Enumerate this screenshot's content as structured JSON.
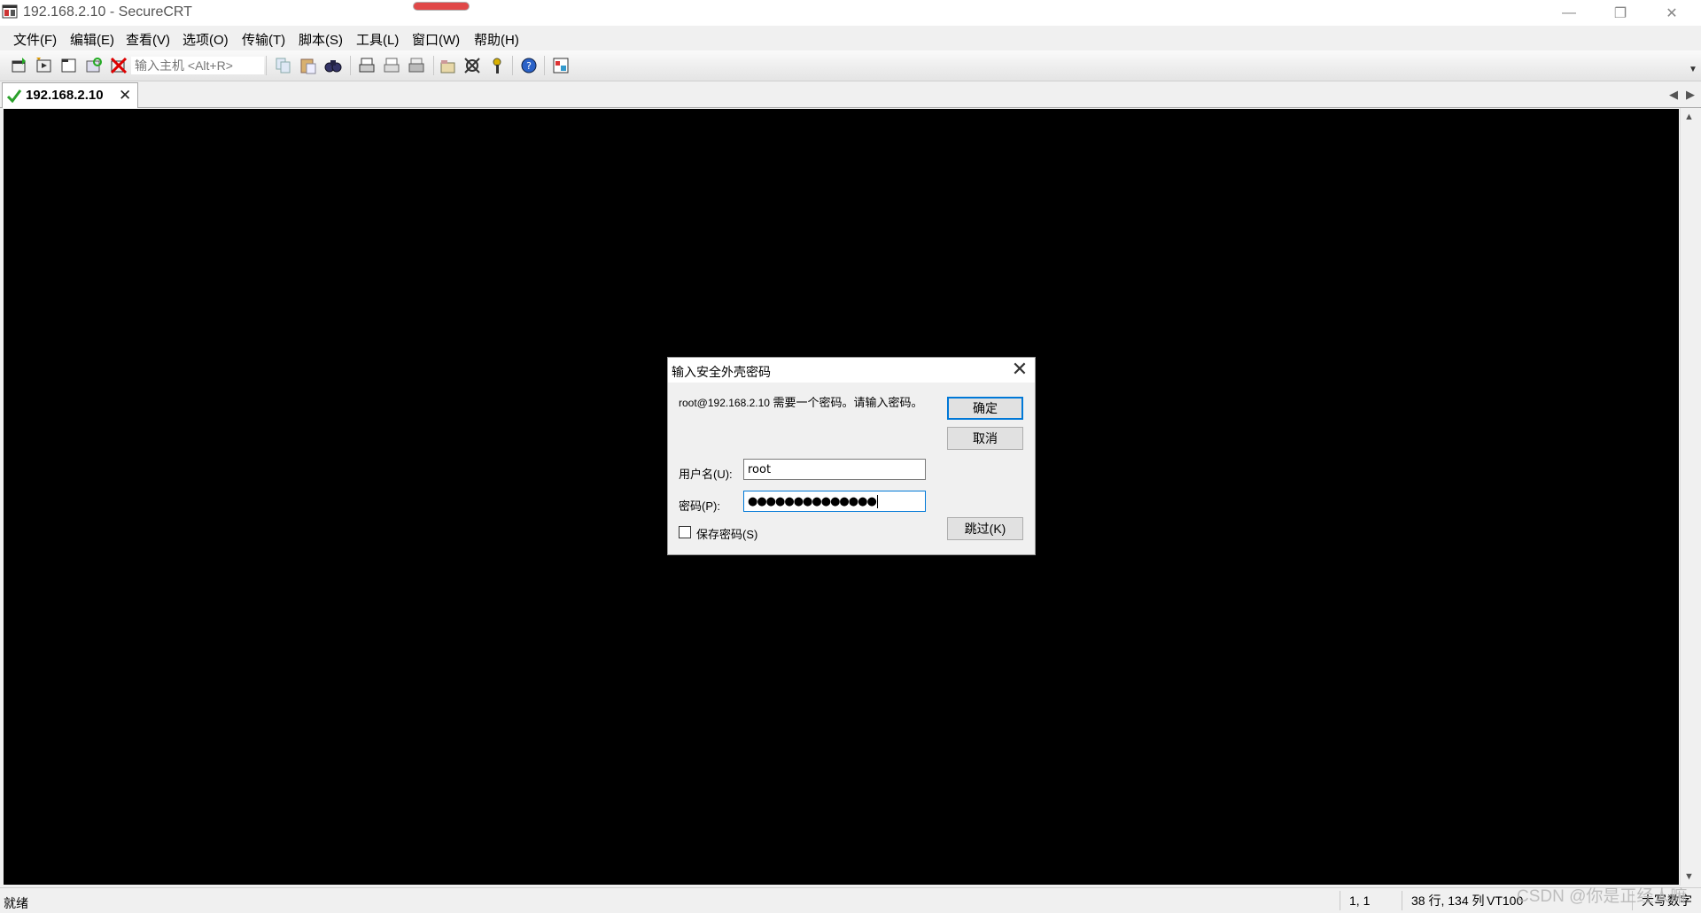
{
  "window": {
    "title": "192.168.2.10 - SecureCRT",
    "minimize_glyph": "—",
    "restore_glyph": "❐",
    "close_glyph": "✕"
  },
  "menu": {
    "items": [
      {
        "label": "文件(F)"
      },
      {
        "label": "编辑(E)"
      },
      {
        "label": "查看(V)"
      },
      {
        "label": "选项(O)"
      },
      {
        "label": "传输(T)"
      },
      {
        "label": "脚本(S)"
      },
      {
        "label": "工具(L)"
      },
      {
        "label": "窗口(W)"
      },
      {
        "label": "帮助(H)"
      }
    ]
  },
  "toolbar": {
    "quick_connect_placeholder": "输入主机 <Alt+R>",
    "icons": [
      "connect-icon",
      "quick-connect-icon",
      "connect-in-tab-icon",
      "reconnect-icon",
      "disconnect-icon",
      "copy-icon",
      "paste-icon",
      "find-icon",
      "print-icon",
      "print-selection-icon",
      "printer-icon",
      "session-options-icon",
      "global-options-icon",
      "keymap-icon",
      "help-icon",
      "sftp-icon"
    ]
  },
  "tabs": {
    "items": [
      {
        "label": "192.168.2.10",
        "status": "connected",
        "close": "✕"
      }
    ],
    "nav_left": "◀",
    "nav_right": "▶"
  },
  "dialog": {
    "title": "输入安全外壳密码",
    "close_glyph": "✕",
    "message_host": "root@192.168.2.10",
    "message_text": " 需要一个密码。请输入密码。",
    "username_label": "用户名(U):",
    "username_value": "root",
    "password_label": "密码(P):",
    "password_masked": "●●●●●●●●●●●●●●",
    "ok_label": "确定",
    "cancel_label": "取消",
    "skip_label": "跳过(K)",
    "save_password_label": "保存密码(S)",
    "save_password_checked": false
  },
  "statusbar": {
    "ready": "就绪",
    "cursor_pos": "1,  1",
    "dimensions": "38 行, 134 列",
    "terminal_type": "VT100",
    "caps": "大写",
    "num": "数字"
  },
  "watermark": "CSDN @你是正经人嘛",
  "colors": {
    "terminal_bg": "#000000",
    "accent": "#0078d7",
    "indicator": "#e04848"
  }
}
